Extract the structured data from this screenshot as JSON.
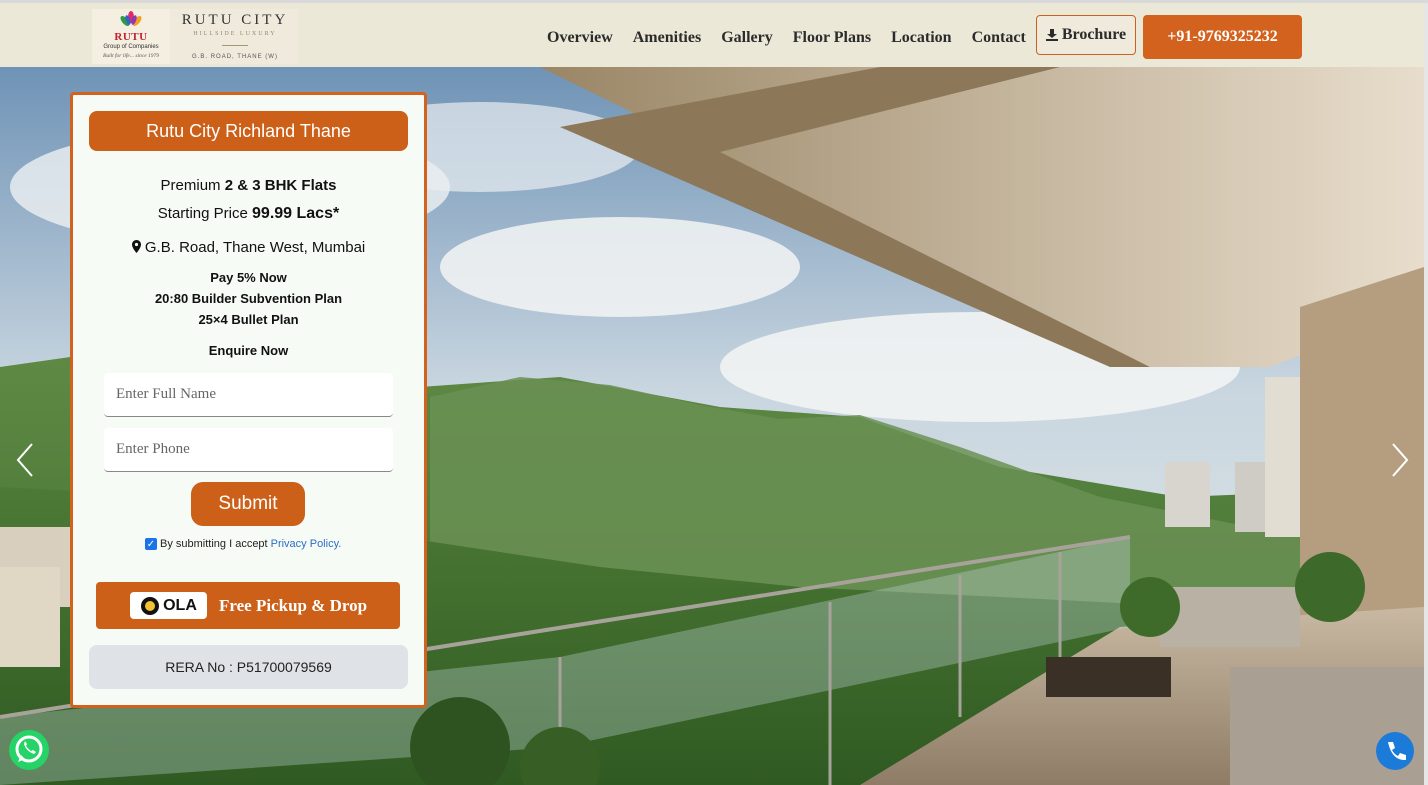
{
  "header": {
    "logo": {
      "brand": "RUTU",
      "group": "Group of Companies",
      "tagline": "Built for life... since 1979",
      "name": "RUTU CITY",
      "subtitle": "HILLSIDE LUXURY",
      "address": "G.B. ROAD, THANE (W)"
    },
    "nav": [
      "Overview",
      "Amenities",
      "Gallery",
      "Floor Plans",
      "Location",
      "Contact"
    ],
    "brochure_label": "Brochure",
    "phone_label": "+91-9769325232"
  },
  "card": {
    "title": "Rutu City Richland Thane",
    "premium_prefix": "Premium ",
    "premium_value": "2 & 3 BHK Flats",
    "price_prefix": "Starting Price ",
    "price_value": "99.99 Lacs*",
    "location": "G.B. Road, Thane West, Mumbai",
    "offers": [
      "Pay 5% Now",
      "20:80 Builder Subvention Plan",
      "25×4 Bullet Plan"
    ],
    "enquire": "Enquire Now",
    "name_placeholder": "Enter Full Name",
    "phone_placeholder": "Enter Phone",
    "submit_label": "Submit",
    "consent_text": "By submitting I accept",
    "policy_link": "Privacy Policy.",
    "ola_brand": "OLA",
    "ola_text": "Free Pickup & Drop",
    "rera": "RERA No : P51700079569"
  },
  "colors": {
    "accent": "#d2621e",
    "header_bg": "#ebe8d8",
    "card_bg": "#f7fbf6",
    "rera_bg": "#dfe2e6",
    "link": "#2a6fc9"
  },
  "icons": [
    "download-icon",
    "map-marker-icon",
    "checkbox-checked-icon",
    "chevron-left-icon",
    "chevron-right-icon",
    "whatsapp-icon",
    "phone-call-icon",
    "ola-circle-icon"
  ]
}
